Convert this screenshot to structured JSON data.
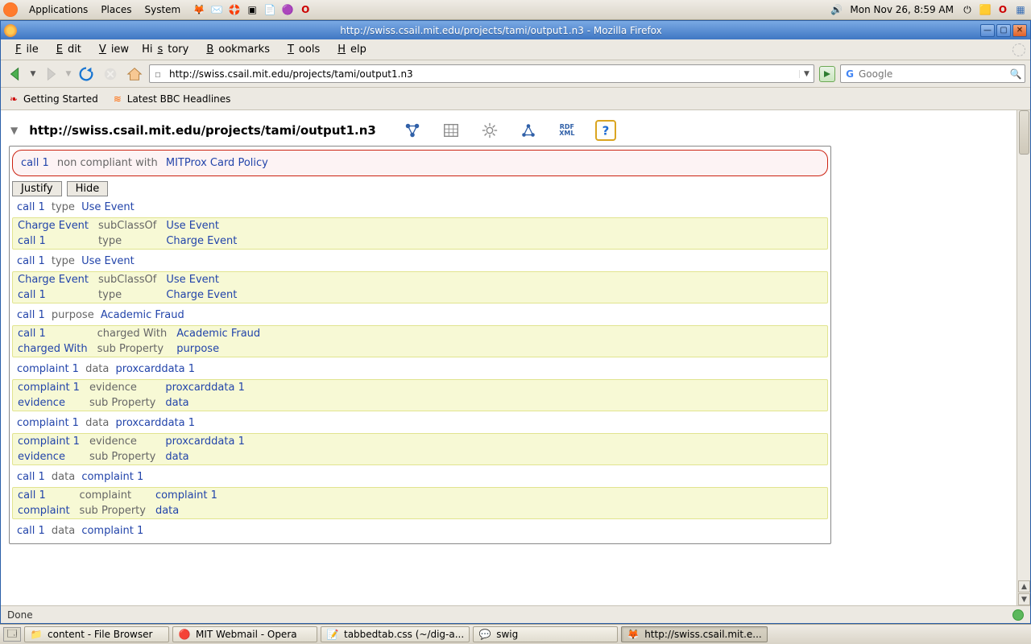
{
  "gnome": {
    "menus": [
      "Applications",
      "Places",
      "System"
    ],
    "clock": "Mon Nov 26,  8:59 AM"
  },
  "firefox": {
    "title": "http://swiss.csail.mit.edu/projects/tami/output1.n3 - Mozilla Firefox",
    "menubar": [
      "File",
      "Edit",
      "View",
      "History",
      "Bookmarks",
      "Tools",
      "Help"
    ],
    "url": "http://swiss.csail.mit.edu/projects/tami/output1.n3",
    "search_placeholder": "Google",
    "bookmarks": [
      "Getting Started",
      "Latest BBC Headlines"
    ],
    "status": "Done"
  },
  "page": {
    "heading": "http://swiss.csail.mit.edu/projects/tami/output1.n3",
    "alert": {
      "subj": "call 1",
      "pred": "non compliant with",
      "obj": "MITProx Card Policy"
    },
    "buttons": {
      "justify": "Justify",
      "hide": "Hide"
    },
    "rows": [
      {
        "kind": "single",
        "s": "call 1",
        "p": "type",
        "o": "Use Event"
      },
      {
        "kind": "block",
        "lines": [
          {
            "s": "Charge Event",
            "p": "subClassOf",
            "o": "Use Event"
          },
          {
            "s": "call 1",
            "p": "type",
            "o": "Charge Event"
          }
        ]
      },
      {
        "kind": "single",
        "s": "call 1",
        "p": "type",
        "o": "Use Event"
      },
      {
        "kind": "block",
        "lines": [
          {
            "s": "Charge Event",
            "p": "subClassOf",
            "o": "Use Event"
          },
          {
            "s": "call 1",
            "p": "type",
            "o": "Charge Event"
          }
        ]
      },
      {
        "kind": "single",
        "s": "call 1",
        "p": "purpose",
        "o": "Academic Fraud"
      },
      {
        "kind": "block",
        "lines": [
          {
            "s": "call 1",
            "p": "charged With",
            "o": "Academic Fraud"
          },
          {
            "s": "charged With",
            "p": "sub Property",
            "o": "purpose"
          }
        ]
      },
      {
        "kind": "single",
        "s": "complaint 1",
        "p": "data",
        "o": "proxcarddata 1"
      },
      {
        "kind": "block",
        "lines": [
          {
            "s": "complaint 1",
            "p": "evidence",
            "o": "proxcarddata 1"
          },
          {
            "s": "evidence",
            "p": "sub Property",
            "o": "data"
          }
        ]
      },
      {
        "kind": "single",
        "s": "complaint 1",
        "p": "data",
        "o": "proxcarddata 1"
      },
      {
        "kind": "block",
        "lines": [
          {
            "s": "complaint 1",
            "p": "evidence",
            "o": "proxcarddata 1"
          },
          {
            "s": "evidence",
            "p": "sub Property",
            "o": "data"
          }
        ]
      },
      {
        "kind": "single",
        "s": "call 1",
        "p": "data",
        "o": "complaint 1"
      },
      {
        "kind": "block",
        "lines": [
          {
            "s": "call 1",
            "p": "complaint",
            "o": "complaint 1"
          },
          {
            "s": "complaint",
            "p": "sub Property",
            "o": "data"
          }
        ]
      },
      {
        "kind": "single",
        "s": "call 1",
        "p": "data",
        "o": "complaint 1"
      }
    ]
  },
  "taskbar": {
    "tasks": [
      {
        "label": "content - File Browser",
        "active": false
      },
      {
        "label": "MIT Webmail - Opera",
        "active": false
      },
      {
        "label": "tabbedtab.css (~/dig-a...",
        "active": false
      },
      {
        "label": "swig",
        "active": false
      },
      {
        "label": "http://swiss.csail.mit.e...",
        "active": true
      }
    ]
  }
}
